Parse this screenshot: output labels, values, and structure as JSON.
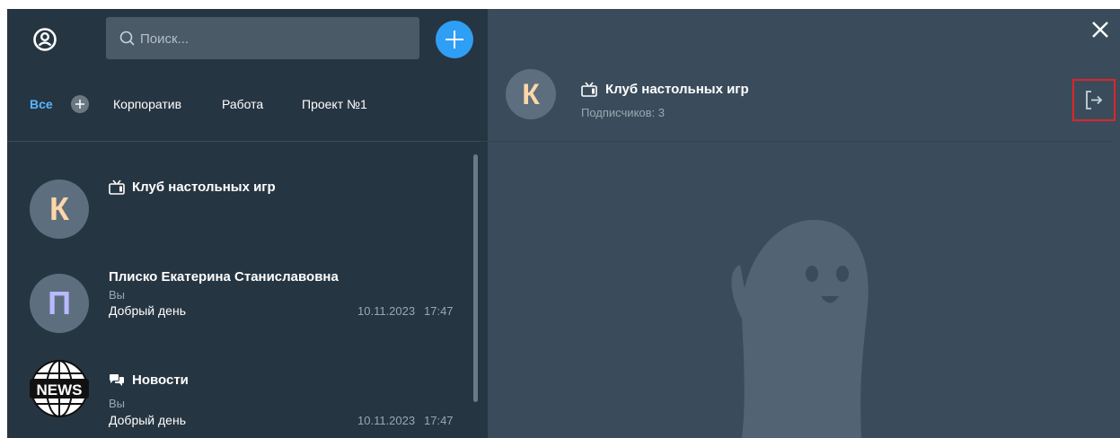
{
  "sidebar": {
    "search": {
      "placeholder": "Поиск..."
    },
    "tabs": [
      {
        "label": "Все",
        "active": true
      },
      {
        "label": "Корпоратив"
      },
      {
        "label": "Работа"
      },
      {
        "label": "Проект №1"
      }
    ],
    "chats": [
      {
        "avatar_letter": "К",
        "avatar_color": "#ffd7a8",
        "icon": "tv-icon",
        "name": "Клуб настольных игр"
      },
      {
        "avatar_letter": "П",
        "avatar_color": "#b9b9ff",
        "name": "Плиско Екатерина Станиславовна",
        "sender": "Вы",
        "message": "Добрый день",
        "date": "10.11.2023",
        "time": "17:47"
      },
      {
        "avatar_logo": "NEWS",
        "icon": "chat-bubbles-icon",
        "name": "Новости",
        "sender": "Вы",
        "message": "Добрый день",
        "date": "10.11.2023",
        "time": "17:47"
      }
    ]
  },
  "conversation": {
    "avatar_letter": "К",
    "icon": "tv-icon",
    "title": "Клуб настольных игр",
    "subscribers": "Подписчиков: 3"
  },
  "colors": {
    "sidebar_bg": "#263542",
    "content_bg": "#3a4c5b",
    "accent": "#2f9ef5",
    "active_tab": "#59b6ff",
    "highlight_border": "#e0242a"
  }
}
